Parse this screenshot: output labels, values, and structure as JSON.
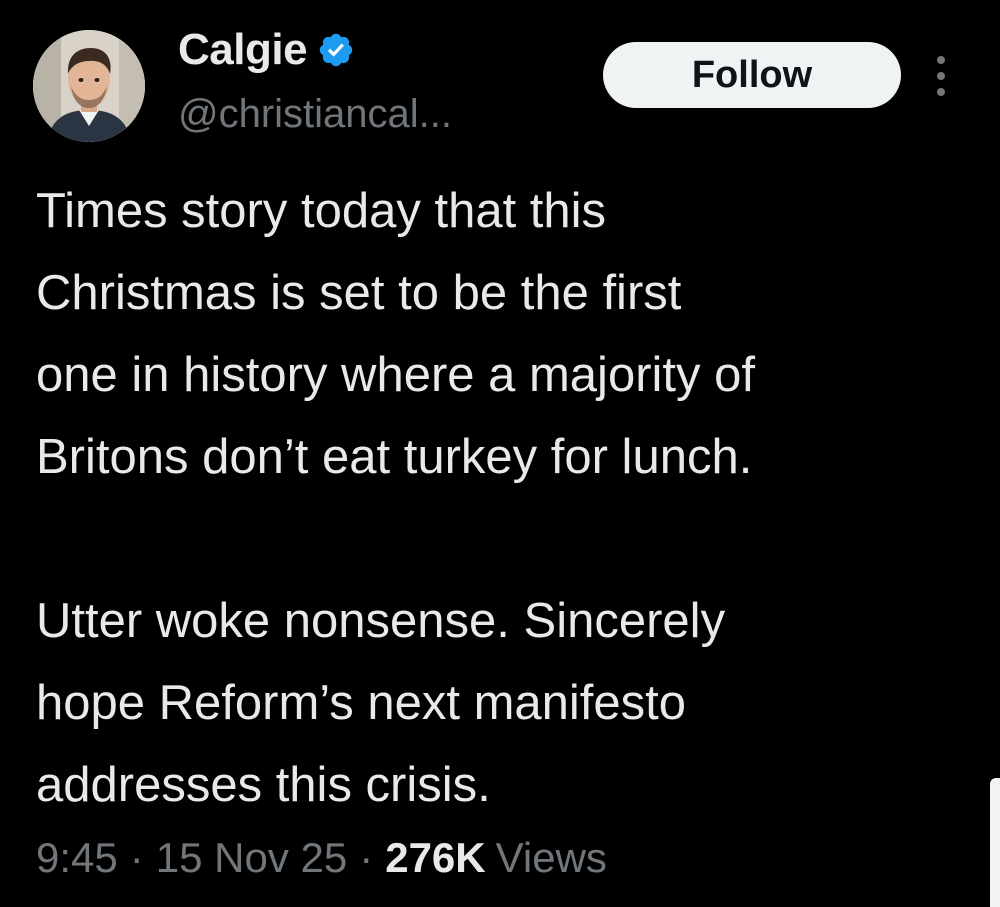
{
  "author": {
    "display_name": "Calgie",
    "handle": "@christiancal...",
    "avatar_icon": "profile-photo",
    "verified_icon": "verified-badge-icon",
    "verified_color": "#1d9bf0"
  },
  "actions": {
    "follow_label": "Follow",
    "more_icon": "more-vertical-icon"
  },
  "tweet": {
    "paragraph_1": [
      "Times story today that this",
      "Christmas is set to be the first",
      "one in history where a majority of",
      "Britons don’t eat turkey for lunch."
    ],
    "paragraph_2": [
      "Utter woke nonsense. Sincerely",
      "hope Reform’s next manifesto",
      "addresses this crisis."
    ]
  },
  "meta": {
    "time": "9:45",
    "separator": "·",
    "date": "15 Nov 25",
    "views_count": "276K",
    "views_label": "Views"
  },
  "colors": {
    "background": "#000000",
    "primary_text": "#e7e9ea",
    "secondary_text": "#71767b",
    "follow_button_bg": "#eff3f4"
  }
}
